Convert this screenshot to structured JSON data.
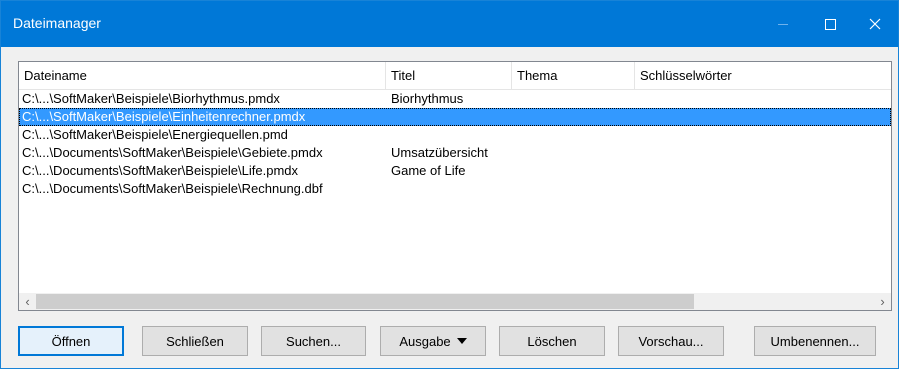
{
  "window": {
    "title": "Dateimanager"
  },
  "columns": [
    "Dateiname",
    "Titel",
    "Thema",
    "Schlüsselwörter"
  ],
  "rows": [
    {
      "name": "C:\\...\\SoftMaker\\Beispiele\\Biorhythmus.pmdx",
      "title": "Biorhythmus",
      "topic": "",
      "keywords": ""
    },
    {
      "name": "C:\\...\\SoftMaker\\Beispiele\\Einheitenrechner.pmdx",
      "title": "",
      "topic": "",
      "keywords": "",
      "selected": true
    },
    {
      "name": "C:\\...\\SoftMaker\\Beispiele\\Energiequellen.pmd",
      "title": "",
      "topic": "",
      "keywords": ""
    },
    {
      "name": "C:\\...\\Documents\\SoftMaker\\Beispiele\\Gebiete.pmdx",
      "title": "Umsatzübersicht",
      "topic": "",
      "keywords": ""
    },
    {
      "name": "C:\\...\\Documents\\SoftMaker\\Beispiele\\Life.pmdx",
      "title": "Game of Life",
      "topic": "",
      "keywords": ""
    },
    {
      "name": "C:\\...\\Documents\\SoftMaker\\Beispiele\\Rechnung.dbf",
      "title": "",
      "topic": "",
      "keywords": ""
    }
  ],
  "buttons": {
    "open": "Öffnen",
    "close": "Schließen",
    "search": "Suchen...",
    "output": "Ausgabe",
    "delete": "Löschen",
    "preview": "Vorschau...",
    "rename": "Umbenennen..."
  },
  "colors": {
    "titlebar": "#0078d7",
    "selection": "#3399ff"
  },
  "icons": {
    "minimize": "minimize-icon",
    "maximize": "maximize-icon",
    "close": "close-icon"
  }
}
